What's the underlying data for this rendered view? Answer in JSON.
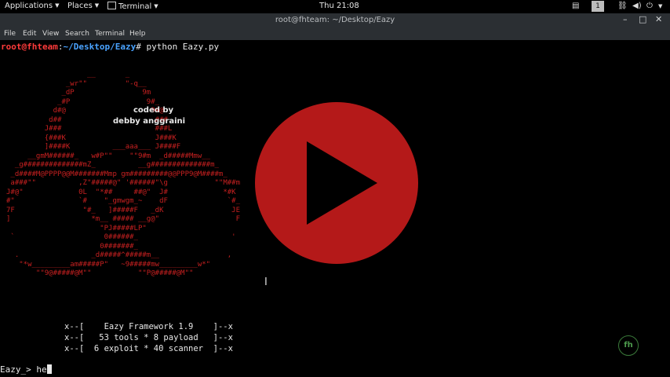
{
  "topbar": {
    "applications": "Applications",
    "places": "Places",
    "terminal": "Terminal",
    "clock": "Thu 21:08",
    "workspace": "1"
  },
  "window": {
    "title": "root@fhteam: ~/Desktop/Eazy"
  },
  "menu": [
    "File",
    "Edit",
    "View",
    "Search",
    "Terminal",
    "Help"
  ],
  "terminal": {
    "prompt_user": "root@fhteam",
    "prompt_sep": ":",
    "prompt_path": "~/Desktop/Eazy",
    "prompt_end": "# ",
    "command": "python Eazy.py",
    "credit_line1": "coded by",
    "credit_line2": "debby anggraini",
    "banner": [
      "x--[    Eazy Framework 1.9    ]--x",
      "x--[   53 tools * 8 payload   ]--x",
      "x--[  6 exploit * 40 scanner  ]--x"
    ],
    "input_prompt": "Eazy_> ",
    "input_text": "he"
  },
  "overlay": {
    "logo_text": "fh"
  },
  "colors": {
    "art": "#c72020",
    "play_button": "#cd1c1c",
    "prompt_user": "#ff3b3b",
    "prompt_path": "#4aa3ff"
  }
}
